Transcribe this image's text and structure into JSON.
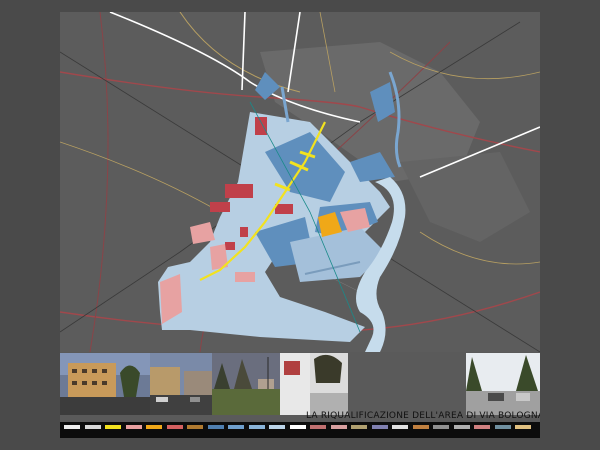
{
  "title": "LA RIQUALIFICAZIONE DELL'AREA DI VIA BOLOGNA",
  "colors": {
    "background": "#4a4a4a",
    "sheet": "#5a5a5a",
    "light_blue_area": "#b7cfe3",
    "mid_blue_area": "#5f8fbd",
    "red_buildings": "#c0404a",
    "pink_areas": "#e7a2a2",
    "yellow_axis": "#f2e21f",
    "orange_block": "#f0a818",
    "river": "#c6dcec",
    "roads_red": "#a0484c",
    "roads_yellow": "#b8a062",
    "white_lines": "#ffffff"
  },
  "photos": [
    {
      "subject": "apartment-building-street"
    },
    {
      "subject": "street-with-parked-cars"
    },
    {
      "subject": "trees-and-field"
    },
    {
      "subject": "white-building-corner"
    },
    {
      "subject": "parking-lot-with-trees"
    }
  ],
  "legend_swatches": [
    "#eeeeee",
    "#d9d9d9",
    "#f2e21f",
    "#e8a0a0",
    "#f0a818",
    "#d46060",
    "#b07a30",
    "#4f7fb0",
    "#6f9fcc",
    "#8ab4d8",
    "#bcd4e8",
    "#ffffff",
    "#c07070",
    "#d8a0a0",
    "#b0a070",
    "#8080b0",
    "#e0e0e0",
    "#c08040",
    "#909090",
    "#b0b0b0",
    "#d08080",
    "#7090a0",
    "#e0c080"
  ]
}
